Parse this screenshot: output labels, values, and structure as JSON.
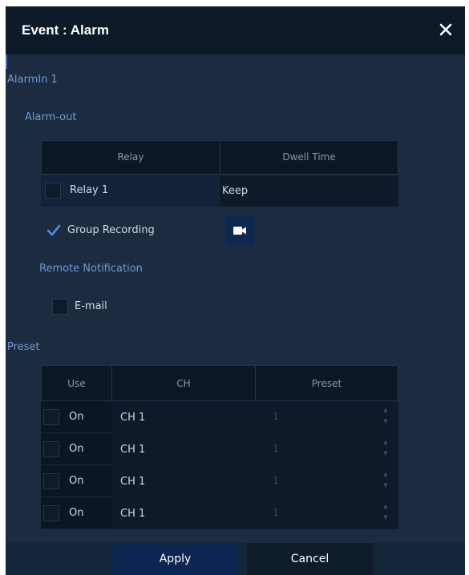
{
  "dialog": {
    "title": "Event : Alarm",
    "close_icon": "close-icon",
    "alarm_in": "AlarmIn 1"
  },
  "alarm_out": {
    "label": "Alarm-out",
    "columns": [
      "Relay",
      "Dwell Time"
    ],
    "relay": {
      "name": "Relay 1",
      "checked": false,
      "dwell": "Keep"
    },
    "group_recording": {
      "label": "Group Recording",
      "checked": true,
      "camera_icon": "video-camera-icon"
    }
  },
  "remote_notification": {
    "label": "Remote Notification",
    "email": {
      "label": "E-mail",
      "checked": false
    }
  },
  "preset": {
    "label": "Preset",
    "columns": [
      "Use",
      "CH",
      "Preset"
    ],
    "rows": [
      {
        "use": "On",
        "ch": "CH 1",
        "preset": "1"
      },
      {
        "use": "On",
        "ch": "CH 1",
        "preset": "1"
      },
      {
        "use": "On",
        "ch": "CH 1",
        "preset": "1"
      },
      {
        "use": "On",
        "ch": "CH 1",
        "preset": "1"
      }
    ]
  },
  "footer": {
    "apply": "Apply",
    "cancel": "Cancel"
  },
  "colors": {
    "panel": "#1c2b3f",
    "titlebar": "#0d1926",
    "accent_blue": "#6f9ad6",
    "check": "#4a8fe0"
  }
}
